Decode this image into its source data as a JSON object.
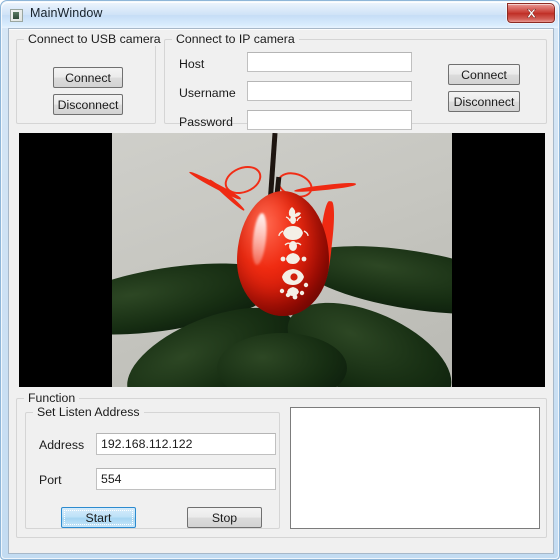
{
  "window": {
    "title": "MainWindow",
    "icon": "app-icon",
    "close_icon": "close-icon",
    "close_glyph": "x"
  },
  "usb_group": {
    "title": "Connect to USB camera",
    "connect_label": "Connect",
    "disconnect_label": "Disconnect"
  },
  "ip_group": {
    "title": "Connect to IP camera",
    "host_label": "Host",
    "host_value": "",
    "host_placeholder": "",
    "username_label": "Username",
    "username_value": "",
    "username_placeholder": "",
    "password_label": "Password",
    "password_value": "",
    "password_placeholder": "",
    "connect_label": "Connect",
    "disconnect_label": "Disconnect"
  },
  "video": {
    "name": "camera-preview",
    "subject": "red decorated easter egg hanging by a red ribbon over dark green leaves",
    "letterbox_color": "#000000"
  },
  "function_group": {
    "title": "Function",
    "listen_group": {
      "title": "Set Listen Address",
      "address_label": "Address",
      "address_value": "192.168.112.122",
      "address_placeholder": "",
      "port_label": "Port",
      "port_value": "554",
      "port_placeholder": "",
      "start_label": "Start",
      "stop_label": "Stop"
    },
    "log": {
      "value": "",
      "placeholder": ""
    }
  },
  "colors": {
    "frame": "#c3dcf2",
    "client": "#f0f0f0",
    "close_red": "#c83c33",
    "focus_blue": "#2c8bcf",
    "egg_red": "#f02c12"
  }
}
